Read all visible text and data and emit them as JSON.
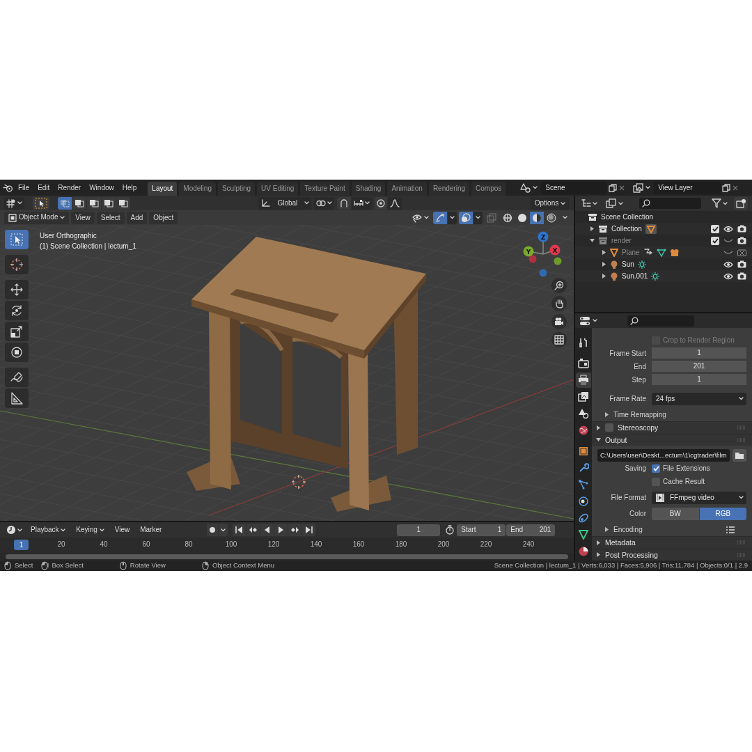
{
  "menu": [
    "File",
    "Edit",
    "Render",
    "Window",
    "Help"
  ],
  "workspaces": [
    {
      "label": "Layout",
      "selected": true
    },
    {
      "label": "Modeling",
      "selected": false
    },
    {
      "label": "Sculpting",
      "selected": false
    },
    {
      "label": "UV Editing",
      "selected": false
    },
    {
      "label": "Texture Paint",
      "selected": false
    },
    {
      "label": "Shading",
      "selected": false
    },
    {
      "label": "Animation",
      "selected": false
    },
    {
      "label": "Rendering",
      "selected": false
    },
    {
      "label": "Compos",
      "selected": false
    }
  ],
  "scene": {
    "value": "Scene"
  },
  "view_layer": {
    "value": "View Layer"
  },
  "tool_header": {
    "select_modes": [
      {
        "selected": true
      },
      {
        "selected": false
      },
      {
        "selected": false
      },
      {
        "selected": false
      },
      {
        "selected": false
      }
    ],
    "orientation": "Global",
    "snap": false,
    "proportional": false,
    "options": "Options"
  },
  "viewport_header": {
    "mode": "Object Mode",
    "menus": [
      "View",
      "Select",
      "Add",
      "Object"
    ],
    "gizmos": true,
    "overlays": true,
    "xray": false,
    "shading_modes": [
      {
        "kind": "wireframe",
        "selected": false
      },
      {
        "kind": "solid",
        "selected": false
      },
      {
        "kind": "material",
        "selected": true
      },
      {
        "kind": "rendered",
        "selected": false
      }
    ]
  },
  "toolbar": [
    {
      "kind": "select",
      "selected": true
    },
    {
      "kind": "cursor",
      "selected": false
    },
    {
      "kind": "move",
      "selected": false
    },
    {
      "kind": "rotate",
      "selected": false
    },
    {
      "kind": "scale",
      "selected": false
    },
    {
      "kind": "transform",
      "selected": false
    },
    {
      "kind": "annotate",
      "selected": false
    },
    {
      "kind": "measure",
      "selected": false
    }
  ],
  "viewport": {
    "view_name": "User Orthographic",
    "collection_info": "(1) Scene Collection | lectum_1",
    "gizmo_axes": [
      "Z",
      "Y",
      "X"
    ]
  },
  "outliner": {
    "items": [
      {
        "name": "Scene Collection",
        "kind": "root",
        "children": [
          {
            "name": "Collection",
            "kind": "collection",
            "expanded": false,
            "checked": true,
            "visible": true,
            "renderable": true,
            "data_icons": [
              {
                "kind": "mesh"
              }
            ]
          },
          {
            "name": "render",
            "kind": "collection",
            "expanded": true,
            "checked": true,
            "visible": false,
            "renderable": true,
            "children": [
              {
                "name": "Plane",
                "kind": "mesh",
                "expanded": false,
                "visible": false,
                "renderable": false,
                "data_icons": [
                  {
                    "kind": "modifier"
                  },
                  {
                    "kind": "meshdata"
                  },
                  {
                    "kind": "material"
                  }
                ]
              },
              {
                "name": "Sun",
                "kind": "light",
                "expanded": false,
                "visible": true,
                "renderable": true,
                "data_icons": [
                  {
                    "kind": "lightdata"
                  }
                ]
              },
              {
                "name": "Sun.001",
                "kind": "light",
                "expanded": false,
                "visible": true,
                "renderable": true,
                "data_icons": [
                  {
                    "kind": "lightdata"
                  }
                ]
              }
            ]
          }
        ]
      }
    ]
  },
  "properties": {
    "tabs": [
      {
        "kind": "tool",
        "selected": false
      },
      {
        "kind": "render",
        "selected": false
      },
      {
        "kind": "output",
        "selected": true
      },
      {
        "kind": "viewlayer",
        "selected": false
      },
      {
        "kind": "scene",
        "selected": false
      },
      {
        "kind": "world",
        "selected": false
      },
      {
        "kind": "object",
        "selected": false
      },
      {
        "kind": "modifiers",
        "selected": false
      },
      {
        "kind": "particles",
        "selected": false
      },
      {
        "kind": "physics",
        "selected": false
      },
      {
        "kind": "constraints",
        "selected": false
      },
      {
        "kind": "data",
        "selected": false
      },
      {
        "kind": "material",
        "selected": false
      }
    ],
    "rows": [
      {
        "kind": "checkbox",
        "text": "Crop to Render Region",
        "checked": false,
        "disabled": true
      },
      {
        "kind": "number",
        "label": "Frame Start",
        "value": "1"
      },
      {
        "kind": "number",
        "label": "End",
        "value": "201"
      },
      {
        "kind": "number",
        "label": "Step",
        "value": "1"
      },
      {
        "kind": "dropdown",
        "label": "Frame Rate",
        "value": "24 fps"
      },
      {
        "kind": "subpanel",
        "label": "Time Remapping",
        "expanded": false,
        "presets": false
      },
      {
        "kind": "panel",
        "label": "Stereoscopy",
        "expanded": false,
        "checked": false
      },
      {
        "kind": "panel",
        "label": "Output",
        "expanded": true
      },
      {
        "kind": "path",
        "value": "C:\\Users\\user\\Deskt...ectum\\1\\cgtrader\\film"
      },
      {
        "kind": "checkbox",
        "label": "Saving",
        "text": "File Extensions",
        "checked": true,
        "disabled": false
      },
      {
        "kind": "checkbox",
        "text": "Cache Result",
        "checked": false,
        "disabled": false
      },
      {
        "kind": "format",
        "label": "File Format",
        "value": "FFmpeg video"
      },
      {
        "kind": "toggle",
        "label": "Color",
        "options": [
          {
            "label": "BW",
            "selected": false
          },
          {
            "label": "RGB",
            "selected": true
          }
        ]
      },
      {
        "kind": "subpanel",
        "label": "Encoding",
        "expanded": false,
        "presets": true
      },
      {
        "kind": "panel",
        "label": "Metadata",
        "expanded": false
      },
      {
        "kind": "panel",
        "label": "Post Processing",
        "expanded": false
      }
    ]
  },
  "timeline": {
    "menus": [
      {
        "label": "Playback",
        "kind": "dropdown"
      },
      {
        "label": "Keying",
        "kind": "dropdown"
      },
      {
        "label": "View",
        "kind": "menu"
      },
      {
        "label": "Marker",
        "kind": "menu"
      }
    ],
    "auto_keying": false,
    "current_frame": "1",
    "start": {
      "label": "Start",
      "value": "1"
    },
    "end": {
      "label": "End",
      "value": "201"
    },
    "ruler_current": "1",
    "ruler_ticks": [
      "20",
      "40",
      "60",
      "80",
      "100",
      "120",
      "140",
      "160",
      "180",
      "200",
      "220",
      "240"
    ]
  },
  "status_bar": {
    "hints": [
      {
        "kind": "left",
        "text": "Select"
      },
      {
        "kind": "drag",
        "text": "Box Select"
      },
      {
        "kind": "middle",
        "text": "Rotate View"
      },
      {
        "kind": "right",
        "text": "Object Context Menu"
      }
    ],
    "stats": "Scene Collection | lectum_1 | Verts:6,033 | Faces:5,906 | Tris:11,784 | Objects:0/1 | 2.9"
  }
}
